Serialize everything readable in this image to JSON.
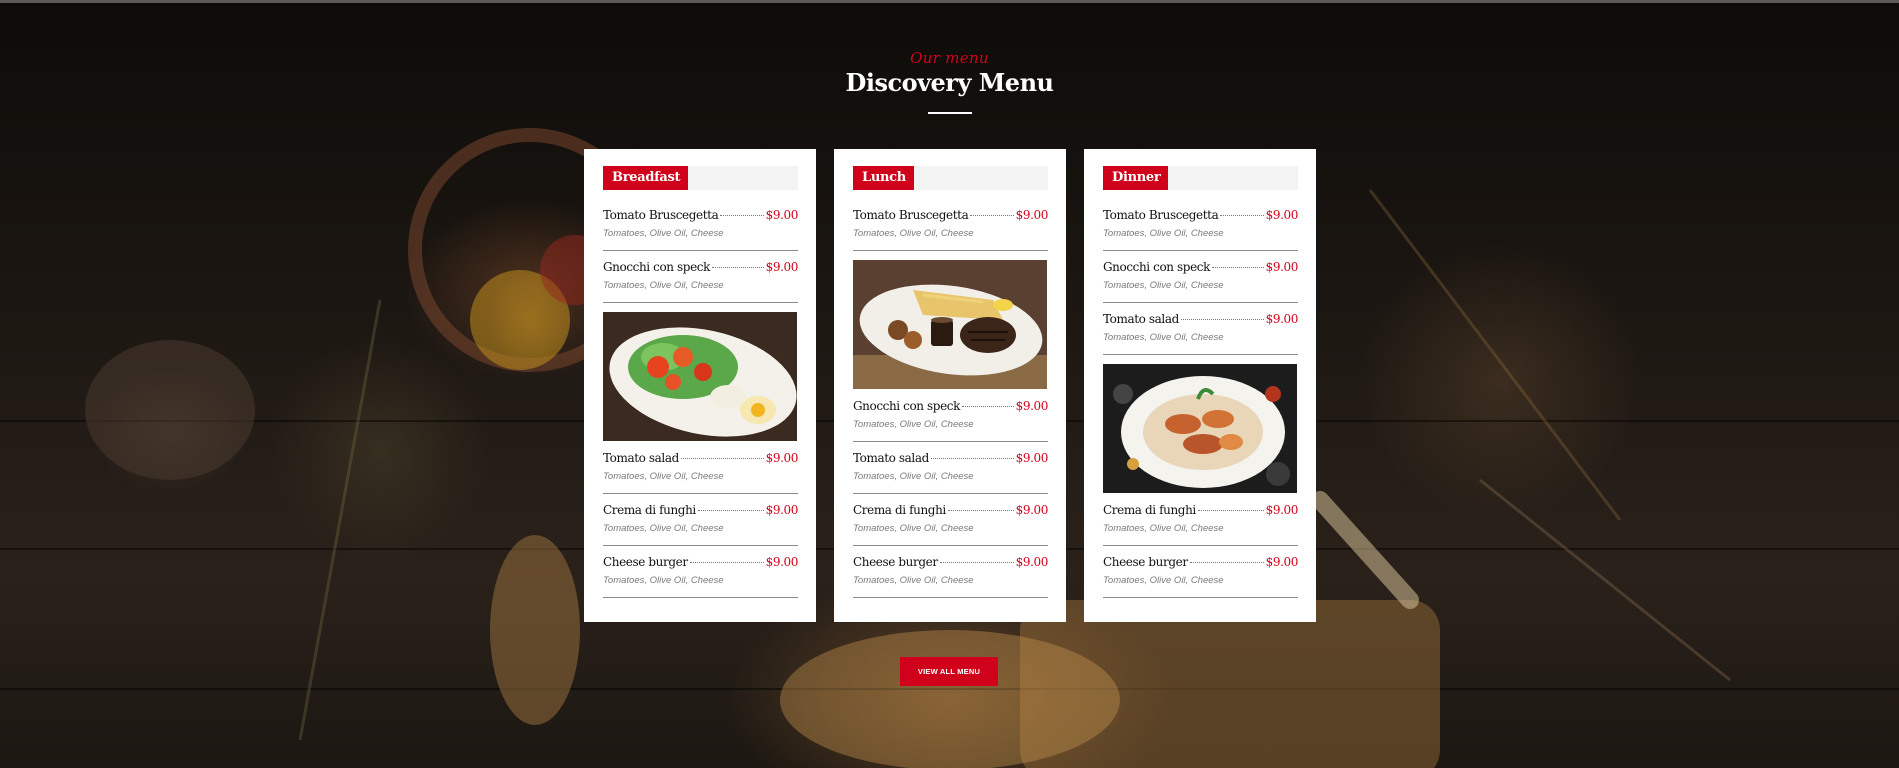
{
  "header": {
    "subtitle": "Our menu",
    "title": "Discovery Menu"
  },
  "menus": [
    {
      "label": "Breadfast",
      "items": [
        {
          "name": "Tomato Bruscegetta",
          "price": "$9.00",
          "desc": "Tomatoes, Olive Oil, Cheese"
        },
        {
          "name": "Gnocchi con speck",
          "price": "$9.00",
          "desc": "Tomatoes, Olive Oil, Cheese"
        },
        {
          "name": "Tomato salad",
          "price": "$9.00",
          "desc": "Tomatoes, Olive Oil, Cheese"
        },
        {
          "name": "Crema di funghi",
          "price": "$9.00",
          "desc": "Tomatoes, Olive Oil, Cheese"
        },
        {
          "name": "Cheese burger",
          "price": "$9.00",
          "desc": "Tomatoes, Olive Oil, Cheese"
        }
      ]
    },
    {
      "label": "Lunch",
      "items": [
        {
          "name": "Tomato Bruscegetta",
          "price": "$9.00",
          "desc": "Tomatoes, Olive Oil, Cheese"
        },
        {
          "name": "Gnocchi con speck",
          "price": "$9.00",
          "desc": "Tomatoes, Olive Oil, Cheese"
        },
        {
          "name": "Tomato salad",
          "price": "$9.00",
          "desc": "Tomatoes, Olive Oil, Cheese"
        },
        {
          "name": "Crema di funghi",
          "price": "$9.00",
          "desc": "Tomatoes, Olive Oil, Cheese"
        },
        {
          "name": "Cheese burger",
          "price": "$9.00",
          "desc": "Tomatoes, Olive Oil, Cheese"
        }
      ]
    },
    {
      "label": "Dinner",
      "items": [
        {
          "name": "Tomato Bruscegetta",
          "price": "$9.00",
          "desc": "Tomatoes, Olive Oil, Cheese"
        },
        {
          "name": "Gnocchi con speck",
          "price": "$9.00",
          "desc": "Tomatoes, Olive Oil, Cheese"
        },
        {
          "name": "Tomato salad",
          "price": "$9.00",
          "desc": "Tomatoes, Olive Oil, Cheese"
        },
        {
          "name": "Crema di funghi",
          "price": "$9.00",
          "desc": "Tomatoes, Olive Oil, Cheese"
        },
        {
          "name": "Cheese burger",
          "price": "$9.00",
          "desc": "Tomatoes, Olive Oil, Cheese"
        }
      ]
    }
  ],
  "button": {
    "label": "VIEW ALL MENU"
  },
  "colors": {
    "accent": "#d0021b",
    "card": "#ffffff",
    "background": "#15110e"
  },
  "icons": [
    "salad-photo",
    "steak-photo",
    "seafood-photo"
  ]
}
